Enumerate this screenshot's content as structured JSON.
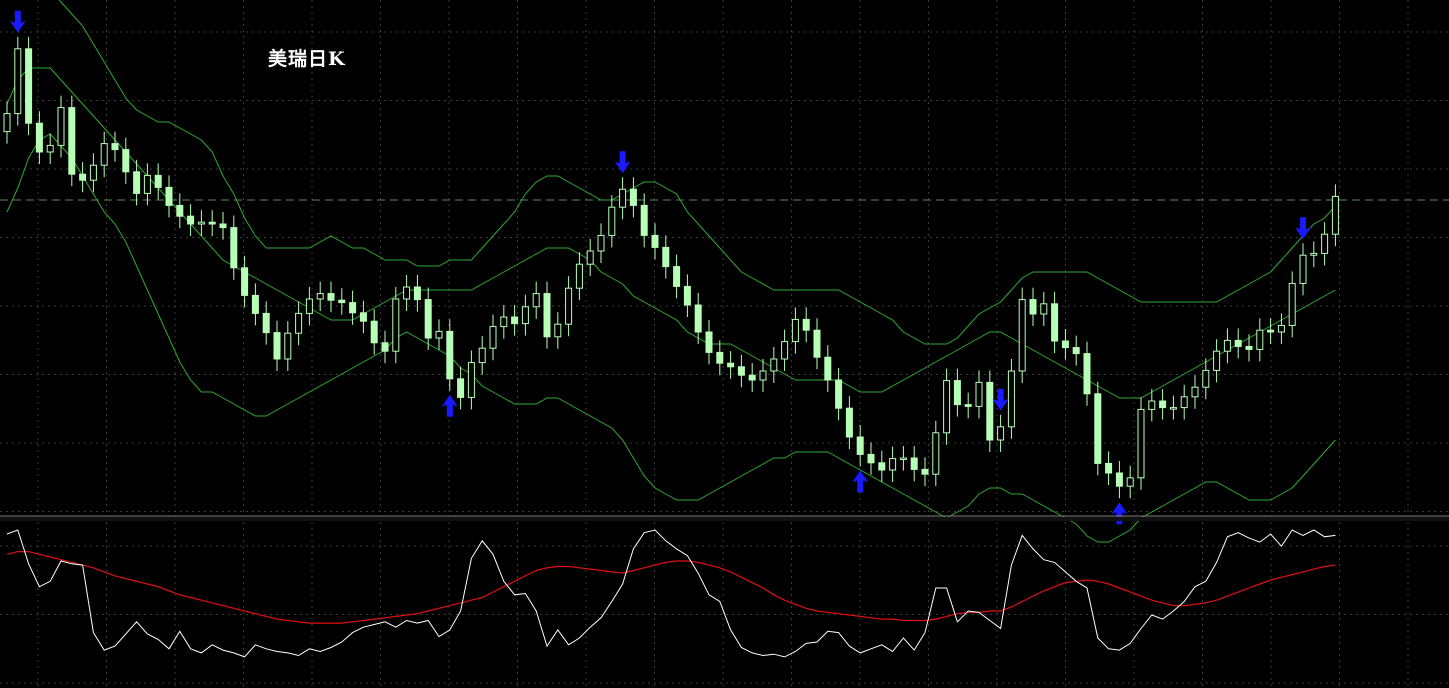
{
  "chart_data": {
    "type": "candlestick",
    "title": "美瑞日K",
    "colors": {
      "background": "#000000",
      "grid": "#3a3a3a",
      "candle": "#b7ffb7",
      "bollinger": "#2faa2f",
      "price_level_line": "#5a8a5a",
      "signal_arrow": "#1a1aff",
      "oscillator_fast": "#ffffff",
      "oscillator_signal": "#e01010",
      "separator": "#808080"
    },
    "grid": true,
    "price_panel": {
      "ylim": [
        0,
        100
      ],
      "level_line": 70.0,
      "closes": [
        84.4,
        95.2,
        82.8,
        78.0,
        79.1,
        85.4,
        74.3,
        73.3,
        75.8,
        79.4,
        78.4,
        74.7,
        71.1,
        74.1,
        72.1,
        69.1,
        67.3,
        66.0,
        66.3,
        66.0,
        65.4,
        58.7,
        54.1,
        51.1,
        47.9,
        43.5,
        47.8,
        51.1,
        53.5,
        54.4,
        53.3,
        52.9,
        51.2,
        49.8,
        46.2,
        44.8,
        53.5,
        55.5,
        53.4,
        47.0,
        48.1,
        40.2,
        37.1,
        42.9,
        45.3,
        48.9,
        50.5,
        49.4,
        52.2,
        54.4,
        47.2,
        49.3,
        55.3,
        59.3,
        61.5,
        64.1,
        68.8,
        71.8,
        69.1,
        64.1,
        62.1,
        58.9,
        55.6,
        52.5,
        48.0,
        44.6,
        42.8,
        42.2,
        40.8,
        40.0,
        41.5,
        43.5,
        46.4,
        50.1,
        48.3,
        43.8,
        40.0,
        35.3,
        30.5,
        27.6,
        26.2,
        25.0,
        26.9,
        27.0,
        25.1,
        24.3,
        31.2,
        39.9,
        35.9,
        35.6,
        39.6,
        30.0,
        32.2,
        41.5,
        53.4,
        51.0,
        52.7,
        46.5,
        45.4,
        44.4,
        37.7,
        26.1,
        24.5,
        22.3,
        23.7,
        35.1,
        36.5,
        35.4,
        35.4,
        37.2,
        38.8,
        41.6,
        44.8,
        46.6,
        45.6,
        45.1,
        48.3,
        48.0,
        49.1,
        56.1,
        60.8,
        61.1,
        64.3,
        70.6
      ],
      "open_delta": 3.0,
      "wick": 2.0,
      "bollinger_upper": [
        104,
        108,
        107,
        106,
        105,
        103,
        101,
        99,
        96,
        93,
        90,
        87,
        85,
        84,
        83,
        83,
        82,
        81,
        80,
        78,
        74,
        71,
        67,
        64,
        62,
        62,
        62,
        62,
        62,
        63,
        64,
        63,
        62,
        62,
        61,
        60,
        60,
        60,
        59,
        59,
        59,
        60,
        60,
        60,
        62,
        64,
        66,
        68,
        71,
        73,
        74,
        74,
        73,
        72,
        71,
        70,
        70,
        71,
        72,
        73,
        73,
        72,
        71,
        68,
        66,
        64,
        62,
        60,
        58,
        57,
        56,
        55,
        55,
        55,
        55,
        55,
        55,
        55,
        54,
        53,
        52,
        51,
        50,
        48,
        47,
        46,
        46,
        46,
        47,
        49,
        51,
        52,
        53,
        55,
        57,
        58,
        58,
        58,
        58,
        58,
        58,
        57,
        56,
        55,
        54,
        53,
        53,
        53,
        53,
        53,
        53,
        53,
        53,
        54,
        55,
        56,
        57,
        58,
        60,
        62,
        64,
        66,
        67,
        69
      ],
      "bollinger_middle": [
        86,
        90,
        92,
        92,
        92,
        90,
        88,
        86,
        84,
        82,
        80,
        78,
        76,
        74,
        72,
        70,
        68,
        66,
        64,
        62,
        60,
        59,
        58,
        57,
        56,
        55,
        54,
        53,
        52,
        51,
        50,
        50,
        50,
        51,
        52,
        53,
        54,
        55,
        55,
        55,
        55,
        55,
        55,
        55,
        56,
        57,
        58,
        59,
        60,
        61,
        62,
        62,
        62,
        61,
        60,
        58,
        57,
        56,
        54,
        53,
        52,
        51,
        50,
        48,
        47,
        46,
        46,
        46,
        45,
        44,
        43,
        42,
        41,
        40,
        40,
        40,
        40,
        40,
        39,
        38,
        38,
        38,
        39,
        40,
        41,
        42,
        43,
        44,
        45,
        46,
        47,
        48,
        48,
        47,
        46,
        45,
        44,
        43,
        42,
        41,
        40,
        39,
        38,
        37,
        37,
        37,
        38,
        39,
        40,
        41,
        42,
        43,
        44,
        45,
        46,
        47,
        48,
        49,
        50,
        51,
        52,
        53,
        54,
        55
      ],
      "bollinger_lower": [
        68,
        72,
        77,
        80,
        81,
        79,
        77,
        74,
        71,
        68,
        66,
        63,
        59,
        55,
        51,
        47,
        43,
        40,
        38,
        38,
        37,
        36,
        35,
        34,
        34,
        35,
        36,
        37,
        38,
        39,
        40,
        41,
        42,
        43,
        44,
        45,
        47,
        48,
        47,
        46,
        45,
        44,
        42,
        41,
        39,
        38,
        37,
        36,
        36,
        36,
        37,
        37,
        36,
        35,
        34,
        33,
        32,
        30,
        27,
        24,
        22,
        21,
        20,
        20,
        20,
        21,
        22,
        23,
        24,
        25,
        26,
        27,
        27,
        28,
        28,
        28,
        28,
        27,
        26,
        25,
        24,
        23,
        22,
        21,
        20,
        19,
        18,
        17,
        18,
        19,
        21,
        22,
        22,
        21,
        21,
        20,
        19,
        18,
        17,
        16,
        14,
        13,
        13,
        14,
        15,
        17,
        18,
        19,
        20,
        21,
        22,
        23,
        23,
        22,
        21,
        20,
        20,
        20,
        21,
        22,
        24,
        26,
        28,
        30
      ],
      "arrows": [
        {
          "index": 1,
          "direction": "down"
        },
        {
          "index": 41,
          "direction": "up"
        },
        {
          "index": 57,
          "direction": "down"
        },
        {
          "index": 79,
          "direction": "up"
        },
        {
          "index": 92,
          "direction": "down"
        },
        {
          "index": 103,
          "direction": "up"
        },
        {
          "index": 120,
          "direction": "down"
        }
      ]
    },
    "oscillator_panel": {
      "ylim": [
        0,
        100
      ],
      "fast_line": [
        97,
        100,
        75,
        58,
        62,
        77,
        75,
        74,
        24,
        11,
        14,
        23,
        32,
        23,
        19,
        12,
        25,
        12,
        9,
        15,
        11,
        9,
        6,
        15,
        12,
        10,
        9,
        7,
        12,
        10,
        13,
        17,
        24,
        28,
        30,
        32,
        28,
        33,
        31,
        33,
        21,
        26,
        40,
        79,
        92,
        82,
        62,
        52,
        53,
        40,
        14,
        26,
        15,
        20,
        28,
        35,
        47,
        60,
        86,
        98,
        100,
        92,
        86,
        81,
        68,
        52,
        47,
        26,
        13,
        9,
        7,
        8,
        6,
        10,
        16,
        17,
        25,
        24,
        14,
        9,
        12,
        15,
        10,
        20,
        11,
        24,
        57,
        57,
        32,
        40,
        39,
        33,
        27,
        74,
        96,
        86,
        78,
        76,
        69,
        62,
        57,
        20,
        12,
        11,
        16,
        27,
        37,
        34,
        40,
        47,
        58,
        62,
        76,
        95,
        98,
        94,
        91,
        97,
        88,
        100,
        96,
        100,
        95,
        96
      ],
      "signal_line": [
        82,
        84,
        84,
        82,
        80,
        78,
        76,
        74,
        72,
        69,
        66,
        64,
        62,
        60,
        58,
        55,
        52,
        50,
        48,
        46,
        44,
        42,
        40,
        38,
        36,
        34,
        33,
        32,
        31,
        31,
        31,
        31,
        32,
        33,
        34,
        35,
        36,
        37,
        38,
        40,
        42,
        44,
        46,
        48,
        50,
        54,
        58,
        62,
        66,
        70,
        72,
        73,
        73,
        72,
        71,
        70,
        69,
        68,
        70,
        72,
        74,
        76,
        77,
        77,
        76,
        74,
        72,
        69,
        65,
        61,
        57,
        52,
        48,
        45,
        42,
        40,
        39,
        38,
        37,
        36,
        35,
        34,
        34,
        33,
        33,
        33,
        34,
        36,
        38,
        39,
        39,
        40,
        40,
        43,
        47,
        51,
        55,
        58,
        61,
        62,
        63,
        62,
        60,
        57,
        54,
        51,
        48,
        46,
        44,
        44,
        45,
        46,
        48,
        51,
        54,
        57,
        60,
        63,
        65,
        67,
        69,
        71,
        73,
        74
      ]
    }
  }
}
